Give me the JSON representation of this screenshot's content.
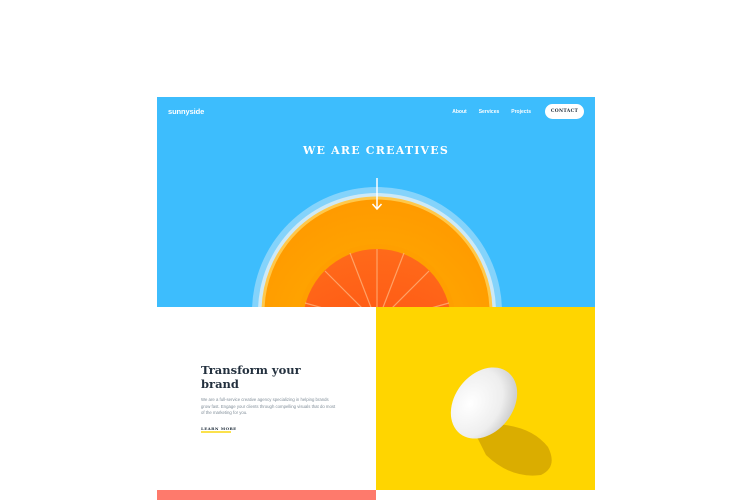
{
  "header": {
    "logo": "sunnyside",
    "nav": [
      {
        "label": "About"
      },
      {
        "label": "Services"
      },
      {
        "label": "Projects"
      }
    ],
    "contact_label": "CONTACT"
  },
  "hero": {
    "title": "WE ARE CREATIVES"
  },
  "transform": {
    "title": "Transform your brand",
    "body": "We are a full-service creative agency specializing in helping brands grow fast. Engage your clients through compelling visuals that do most of the marketing for you.",
    "link": "LEARN MORE"
  },
  "colors": {
    "hero_bg": "#3dbdfd",
    "yellow": "#ffd500",
    "coral": "#fe7a6c",
    "dark_text": "#23303e"
  }
}
